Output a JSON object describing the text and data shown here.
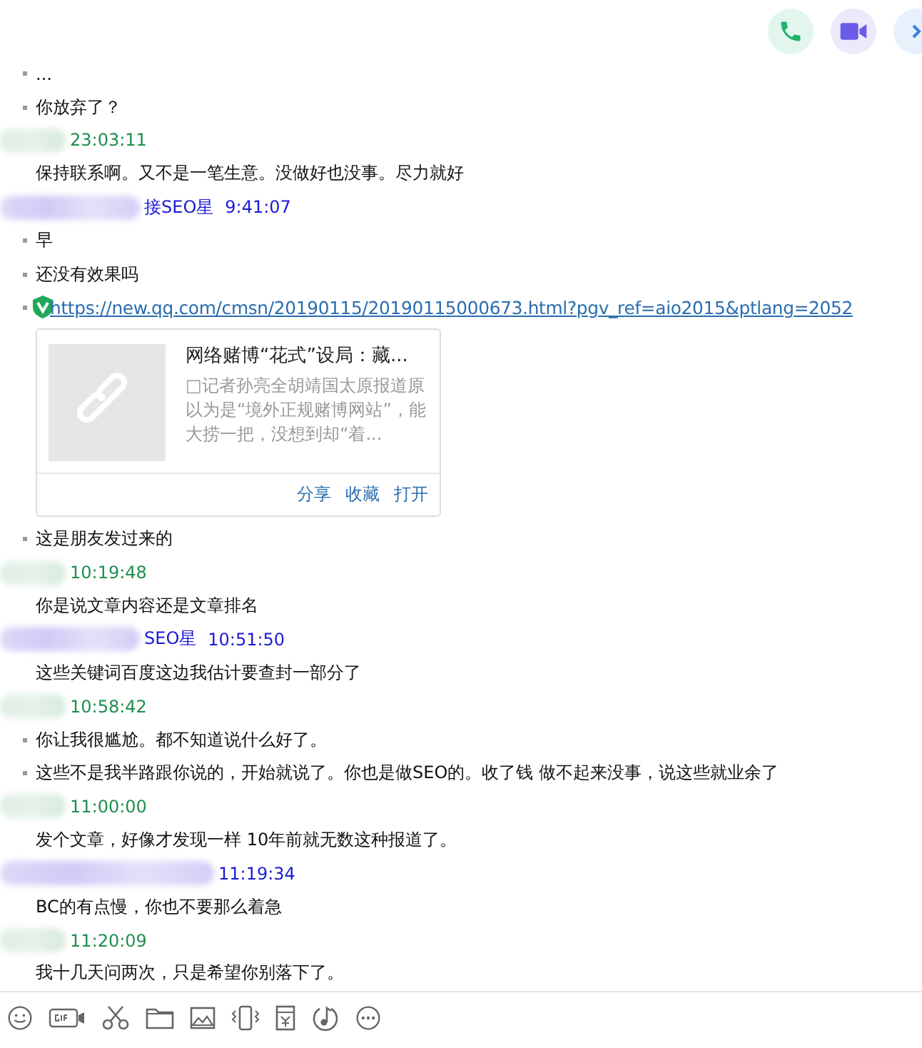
{
  "call_buttons": [
    {
      "kind": "phone"
    },
    {
      "kind": "video"
    },
    {
      "kind": "more"
    }
  ],
  "messages": [
    {
      "kind": "text",
      "text": "...",
      "dot": true
    },
    {
      "kind": "text",
      "text": "你放弃了？",
      "dot": true
    },
    {
      "kind": "peer-header",
      "time": "23:03:11"
    },
    {
      "kind": "text",
      "text": "保持联系啊。又不是一笔生意。没做好也没事。尽力就好",
      "dot": false
    },
    {
      "kind": "self-header",
      "name": "接SEO星",
      "time": "9:41:07"
    },
    {
      "kind": "text",
      "text": "早",
      "dot": true
    },
    {
      "kind": "text",
      "text": "还没有效果吗",
      "dot": true
    },
    {
      "kind": "link",
      "text": "https://new.qq.com/cmsn/20190115/20190115000673.html?pgv_ref=aio2015&ptlang=2052",
      "dot": true,
      "card": {
        "title": "网络赌博“花式”设局：藏...",
        "description": "□记者孙亮全胡靖国太原报道原以为是“境外正规赌博网站”，能大捞一把，没想到却“着...",
        "actions": [
          "分享",
          "收藏",
          "打开"
        ]
      }
    },
    {
      "kind": "text",
      "text": "这是朋友发过来的",
      "dot": true
    },
    {
      "kind": "peer-header",
      "time": "10:19:48"
    },
    {
      "kind": "text",
      "text": "你是说文章内容还是文章排名",
      "dot": false
    },
    {
      "kind": "self-header",
      "name": "SEO星",
      "time": "10:51:50"
    },
    {
      "kind": "text",
      "text": "这些关键词百度这边我估计要查封一部分了",
      "dot": false
    },
    {
      "kind": "peer-header",
      "time": "10:58:42"
    },
    {
      "kind": "text",
      "text": "你让我很尴尬。都不知道说什么好了。",
      "dot": true
    },
    {
      "kind": "text",
      "text": "这些不是我半路跟你说的，开始就说了。你也是做SEO的。收了钱 做不起来没事，说这些就业余了",
      "dot": true
    },
    {
      "kind": "peer-header",
      "time": "11:00:00"
    },
    {
      "kind": "text",
      "text": "发个文章，好像才发现一样 10年前就无数这种报道了。",
      "dot": false
    },
    {
      "kind": "self-header",
      "time": "11:19:34"
    },
    {
      "kind": "text",
      "text": "BC的有点慢，你也不要那么着急",
      "dot": false
    },
    {
      "kind": "peer-header",
      "time": "11:20:09"
    },
    {
      "kind": "text",
      "text": "我十几天问两次，只是希望你别落下了。",
      "dot": false
    }
  ],
  "toolbar": [
    {
      "kind": "emoji"
    },
    {
      "kind": "gif"
    },
    {
      "kind": "scissors"
    },
    {
      "kind": "folder"
    },
    {
      "kind": "image"
    },
    {
      "kind": "shake"
    },
    {
      "kind": "red-packet"
    },
    {
      "kind": "music"
    },
    {
      "kind": "more"
    }
  ]
}
